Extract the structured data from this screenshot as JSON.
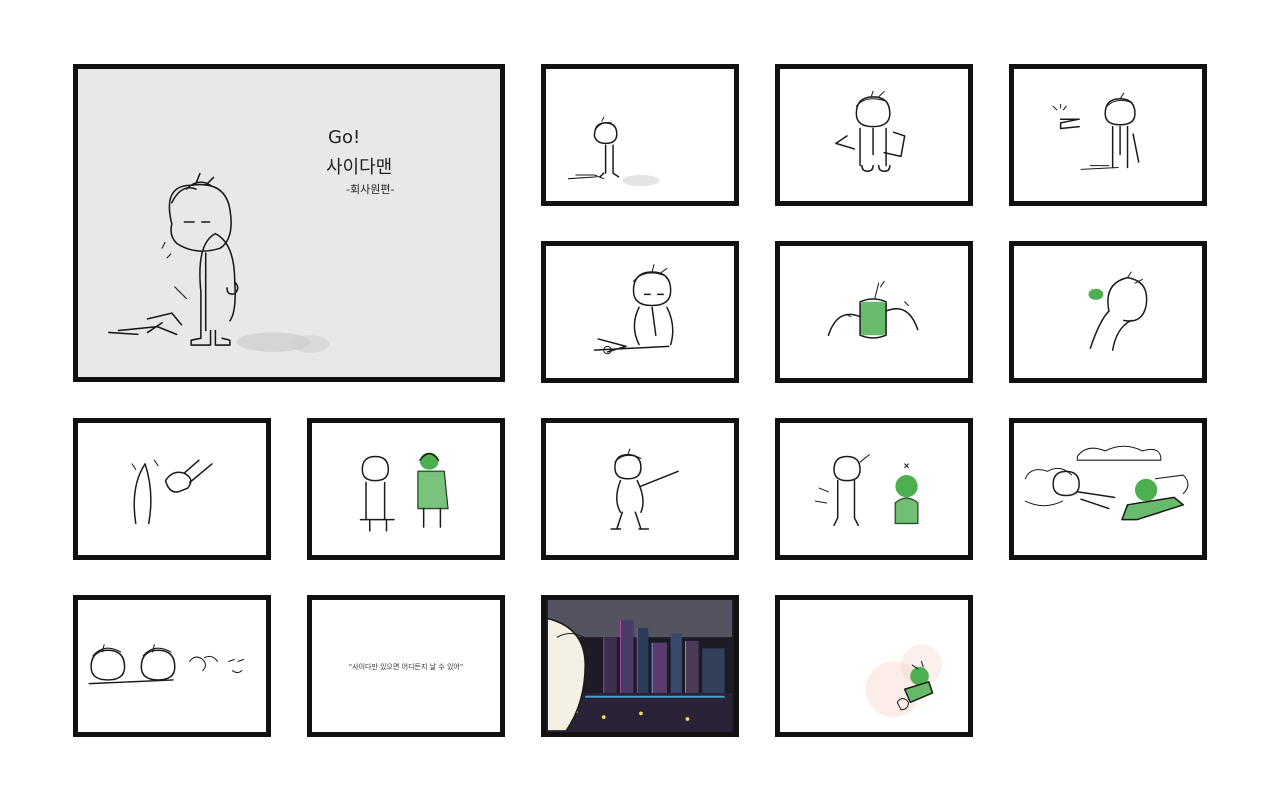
{
  "cover": {
    "line1": "Go!",
    "line2": "사이다맨",
    "line3": "-회사원편-"
  },
  "panels": [
    {
      "id": "panel-cover"
    },
    {
      "id": "panel-2"
    },
    {
      "id": "panel-3"
    },
    {
      "id": "panel-4"
    },
    {
      "id": "panel-5"
    },
    {
      "id": "panel-6"
    },
    {
      "id": "panel-7"
    },
    {
      "id": "panel-8"
    },
    {
      "id": "panel-9"
    },
    {
      "id": "panel-10"
    },
    {
      "id": "panel-11"
    },
    {
      "id": "panel-12"
    },
    {
      "id": "panel-13"
    },
    {
      "id": "panel-14"
    },
    {
      "id": "panel-15"
    },
    {
      "id": "panel-16"
    }
  ],
  "caption_panel": {
    "text": "\"사이다만 있으면 어디든지 날 수 있어\""
  },
  "colors": {
    "hero_green": "#4caf50",
    "cover_bg": "#e8e8e6",
    "border": "#111111"
  }
}
